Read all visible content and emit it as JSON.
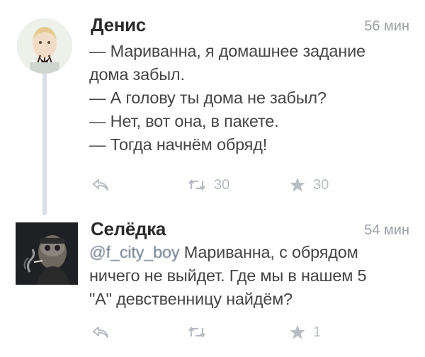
{
  "tweets": [
    {
      "name": "Денис",
      "time": "56 мин",
      "lines": [
        "— Мариванна, я домашнее задание",
        "дома забыл.",
        "— А голову ты дома не забыл?",
        "— Нет, вот она, в пакете.",
        "— Тогда начнём обряд!"
      ],
      "retweet_count": "30",
      "like_count": "30",
      "icons": {
        "reply": "reply-icon",
        "retweet": "retweet-icon",
        "like": "star-icon"
      }
    },
    {
      "name": "Селёдка",
      "time": "54 мин",
      "mention": "@f_city_boy",
      "first_line_rest": " Мариванна, с обрядом",
      "lines": [
        "ничего не выйдет. Где мы в нашем 5",
        "\"А\" девственницу найдём?"
      ],
      "retweet_count": "",
      "like_count": "1",
      "icons": {
        "reply": "reply-icon",
        "retweet": "retweet-icon",
        "like": "star-icon"
      }
    }
  ],
  "colors": {
    "text": "#454545",
    "meta": "#9a9fa5",
    "icon": "#b7bcc2",
    "thread": "#d9dfe5"
  }
}
